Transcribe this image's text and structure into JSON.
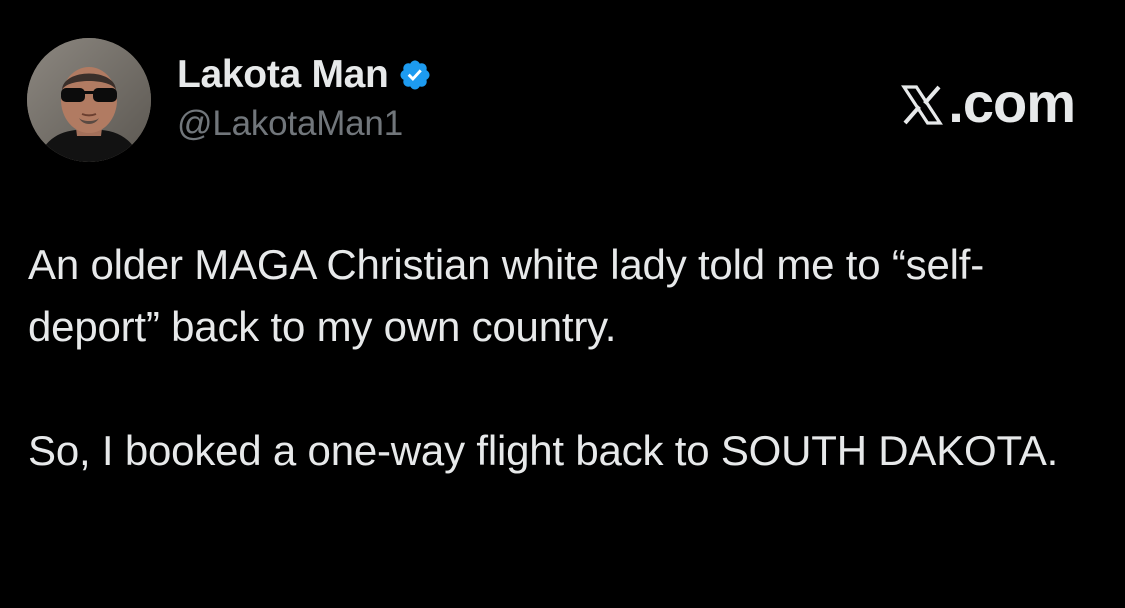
{
  "author": {
    "name": "Lakota Man",
    "handle": "@LakotaMan1",
    "verified": true,
    "avatar_icon": "profile-photo"
  },
  "brand": {
    "label": ".com",
    "logo_icon": "x-logo-icon"
  },
  "tweet": {
    "paragraphs": [
      "An older MAGA Christian white lady told me to “self-deport” back to my own country.",
      "So, I booked a one-way flight back to SOUTH DAKOTA."
    ]
  },
  "colors": {
    "background": "#000000",
    "text": "#e7e9ea",
    "secondary_text": "#71767b",
    "verified_badge": "#1d9bf0"
  }
}
